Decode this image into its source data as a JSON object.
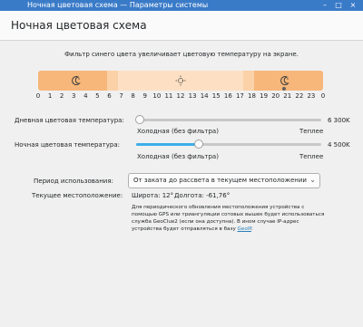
{
  "window": {
    "title": "Ночная цветовая схема — Параметры системы",
    "controls": [
      "–",
      "□",
      "×"
    ]
  },
  "page": {
    "title": "Ночная цветовая схема"
  },
  "description": "Фильтр синего цвета увеличивает цветовую температуру на экране.",
  "timeline": {
    "hours": [
      "0",
      "1",
      "2",
      "3",
      "4",
      "5",
      "6",
      "7",
      "8",
      "9",
      "10",
      "11",
      "12",
      "13",
      "14",
      "15",
      "16",
      "17",
      "18",
      "19",
      "20",
      "21",
      "22",
      "23",
      "0"
    ],
    "icons": [
      "moon-icon",
      "sun-icon",
      "moon-icon"
    ],
    "current_hour": 20.75
  },
  "day_temperature": {
    "label": "Дневная цветовая температура:",
    "value": "6 300K",
    "min_label": "Холодная (без фильтра)",
    "max_label": "Теплее",
    "level": 0.02
  },
  "night_temperature": {
    "label": "Ночная цветовая температура:",
    "value": "4 500K",
    "min_label": "Холодная (без фильтра)",
    "max_label": "Теплее",
    "level": 0.34
  },
  "period": {
    "label": "Период использования:",
    "selected": "От заката до рассвета в текущем местоположении"
  },
  "location": {
    "label": "Текущее местоположение:",
    "latitude": "Широта: 12°",
    "longitude": "Долгота: -61,76°"
  },
  "note": {
    "text": "Для периодического обновления местоположения устройства с помощью GPS или триангуляции сотовых вышек будет использоваться служба GeoClue2 (если она доступна). В ином случае IP-адрес устройства будет отправляться в базу",
    "link": "GeoIP",
    "end": "."
  },
  "colors": {
    "accent": "#3daee9",
    "titlebar": "#3a7bc8",
    "night_segment": "#f7b77a",
    "day_segment": "#fde0c3"
  }
}
